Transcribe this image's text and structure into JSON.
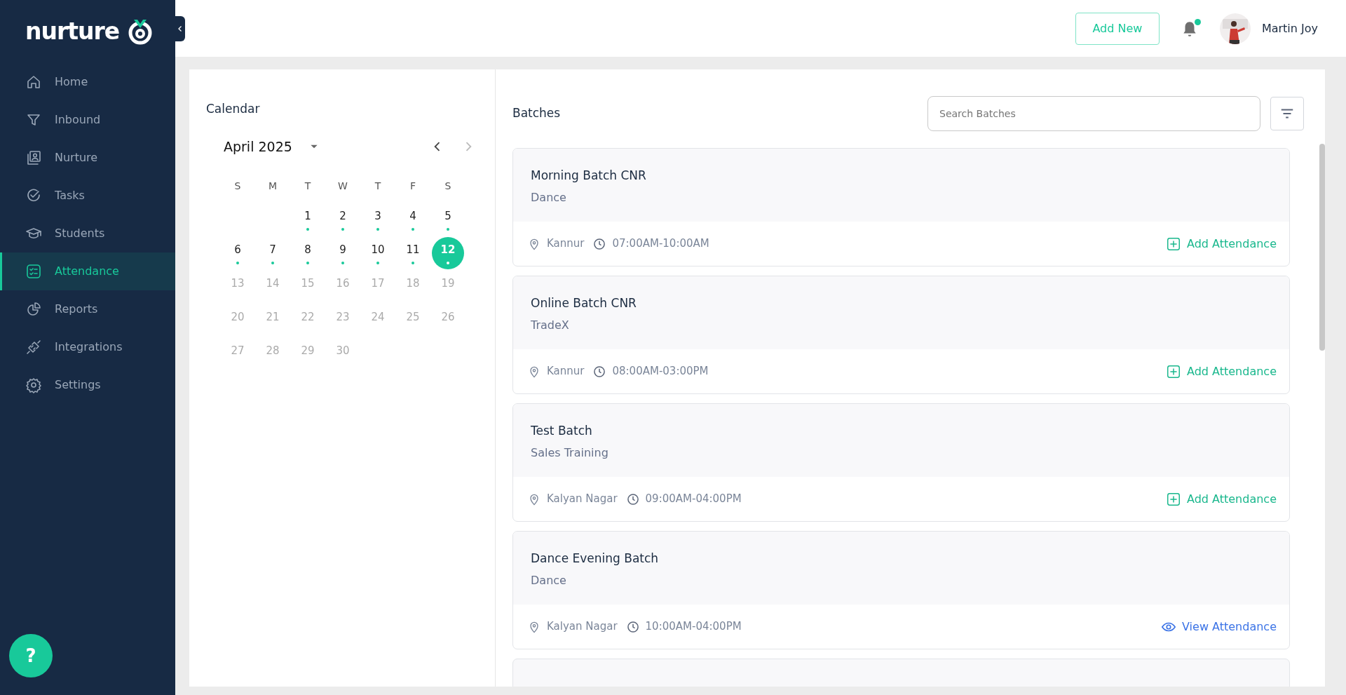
{
  "sidebar": {
    "brand": "nurture",
    "items": [
      {
        "label": "Home",
        "selected": false
      },
      {
        "label": "Inbound",
        "selected": false
      },
      {
        "label": "Nurture",
        "selected": false
      },
      {
        "label": "Tasks",
        "selected": false
      },
      {
        "label": "Students",
        "selected": false
      },
      {
        "label": "Attendance",
        "selected": true
      },
      {
        "label": "Reports",
        "selected": false
      },
      {
        "label": "Integrations",
        "selected": false
      },
      {
        "label": "Settings",
        "selected": false
      }
    ],
    "help": "?"
  },
  "header": {
    "add_button": "Add New",
    "notification_dot": true,
    "user_name": "Martin Joy"
  },
  "calendar": {
    "title": "Calendar",
    "month": "April 2025",
    "weekdays": [
      "S",
      "M",
      "T",
      "W",
      "T",
      "F",
      "S"
    ],
    "days": [
      {
        "label": "1",
        "selected": false,
        "disabled": false,
        "marked": true
      },
      {
        "label": "2",
        "selected": false,
        "disabled": false,
        "marked": true
      },
      {
        "label": "3",
        "selected": false,
        "disabled": false,
        "marked": true
      },
      {
        "label": "4",
        "selected": false,
        "disabled": false,
        "marked": true
      },
      {
        "label": "5",
        "selected": false,
        "disabled": false,
        "marked": true
      },
      {
        "label": "6",
        "selected": false,
        "disabled": false,
        "marked": true
      },
      {
        "label": "7",
        "selected": false,
        "disabled": false,
        "marked": true
      },
      {
        "label": "8",
        "selected": false,
        "disabled": false,
        "marked": true
      },
      {
        "label": "9",
        "selected": false,
        "disabled": false,
        "marked": true
      },
      {
        "label": "10",
        "selected": false,
        "disabled": false,
        "marked": true
      },
      {
        "label": "11",
        "selected": false,
        "disabled": false,
        "marked": true
      },
      {
        "label": "12",
        "selected": true,
        "disabled": false,
        "marked": true
      },
      {
        "label": "13",
        "selected": false,
        "disabled": true,
        "marked": false
      },
      {
        "label": "14",
        "selected": false,
        "disabled": true,
        "marked": false
      },
      {
        "label": "15",
        "selected": false,
        "disabled": true,
        "marked": false
      },
      {
        "label": "16",
        "selected": false,
        "disabled": true,
        "marked": false
      },
      {
        "label": "17",
        "selected": false,
        "disabled": true,
        "marked": false
      },
      {
        "label": "18",
        "selected": false,
        "disabled": true,
        "marked": false
      },
      {
        "label": "19",
        "selected": false,
        "disabled": true,
        "marked": false
      },
      {
        "label": "20",
        "selected": false,
        "disabled": true,
        "marked": false
      },
      {
        "label": "21",
        "selected": false,
        "disabled": true,
        "marked": false
      },
      {
        "label": "22",
        "selected": false,
        "disabled": true,
        "marked": false
      },
      {
        "label": "23",
        "selected": false,
        "disabled": true,
        "marked": false
      },
      {
        "label": "24",
        "selected": false,
        "disabled": true,
        "marked": false
      },
      {
        "label": "25",
        "selected": false,
        "disabled": true,
        "marked": false
      },
      {
        "label": "26",
        "selected": false,
        "disabled": true,
        "marked": false
      },
      {
        "label": "27",
        "selected": false,
        "disabled": true,
        "marked": false
      },
      {
        "label": "28",
        "selected": false,
        "disabled": true,
        "marked": false
      },
      {
        "label": "29",
        "selected": false,
        "disabled": true,
        "marked": false
      },
      {
        "label": "30",
        "selected": false,
        "disabled": true,
        "marked": false
      }
    ]
  },
  "batches": {
    "title": "Batches",
    "search": {
      "placeholder": "Search Batches"
    },
    "items": [
      {
        "name": "Morning Batch CNR",
        "course": "Dance",
        "location": "Kannur",
        "time": "07:00AM-10:00AM",
        "action": {
          "kind": "add",
          "label": "Add Attendance"
        }
      },
      {
        "name": "Online Batch CNR",
        "course": "TradeX",
        "location": "Kannur",
        "time": "08:00AM-03:00PM",
        "action": {
          "kind": "add",
          "label": "Add Attendance"
        }
      },
      {
        "name": "Test Batch",
        "course": "Sales Training",
        "location": "Kalyan Nagar",
        "time": "09:00AM-04:00PM",
        "action": {
          "kind": "add",
          "label": "Add Attendance"
        }
      },
      {
        "name": "Dance Evening Batch",
        "course": "Dance",
        "location": "Kalyan Nagar",
        "time": "10:00AM-04:00PM",
        "action": {
          "kind": "view",
          "label": "View Attendance"
        }
      }
    ],
    "partial_card": true
  }
}
